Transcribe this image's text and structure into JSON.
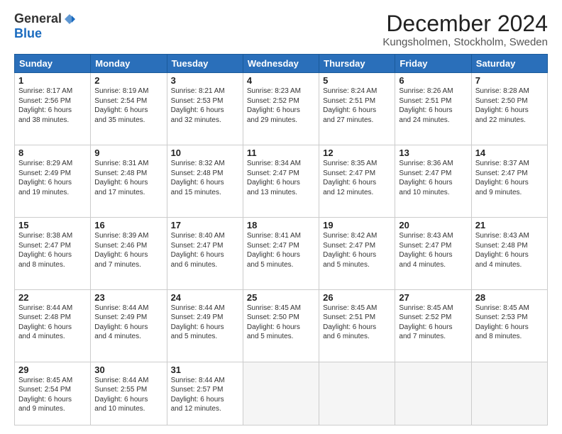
{
  "logo": {
    "general": "General",
    "blue": "Blue"
  },
  "title": "December 2024",
  "location": "Kungsholmen, Stockholm, Sweden",
  "days_header": [
    "Sunday",
    "Monday",
    "Tuesday",
    "Wednesday",
    "Thursday",
    "Friday",
    "Saturday"
  ],
  "weeks": [
    [
      {
        "day": "1",
        "info": "Sunrise: 8:17 AM\nSunset: 2:56 PM\nDaylight: 6 hours\nand 38 minutes."
      },
      {
        "day": "2",
        "info": "Sunrise: 8:19 AM\nSunset: 2:54 PM\nDaylight: 6 hours\nand 35 minutes."
      },
      {
        "day": "3",
        "info": "Sunrise: 8:21 AM\nSunset: 2:53 PM\nDaylight: 6 hours\nand 32 minutes."
      },
      {
        "day": "4",
        "info": "Sunrise: 8:23 AM\nSunset: 2:52 PM\nDaylight: 6 hours\nand 29 minutes."
      },
      {
        "day": "5",
        "info": "Sunrise: 8:24 AM\nSunset: 2:51 PM\nDaylight: 6 hours\nand 27 minutes."
      },
      {
        "day": "6",
        "info": "Sunrise: 8:26 AM\nSunset: 2:51 PM\nDaylight: 6 hours\nand 24 minutes."
      },
      {
        "day": "7",
        "info": "Sunrise: 8:28 AM\nSunset: 2:50 PM\nDaylight: 6 hours\nand 22 minutes."
      }
    ],
    [
      {
        "day": "8",
        "info": "Sunrise: 8:29 AM\nSunset: 2:49 PM\nDaylight: 6 hours\nand 19 minutes."
      },
      {
        "day": "9",
        "info": "Sunrise: 8:31 AM\nSunset: 2:48 PM\nDaylight: 6 hours\nand 17 minutes."
      },
      {
        "day": "10",
        "info": "Sunrise: 8:32 AM\nSunset: 2:48 PM\nDaylight: 6 hours\nand 15 minutes."
      },
      {
        "day": "11",
        "info": "Sunrise: 8:34 AM\nSunset: 2:47 PM\nDaylight: 6 hours\nand 13 minutes."
      },
      {
        "day": "12",
        "info": "Sunrise: 8:35 AM\nSunset: 2:47 PM\nDaylight: 6 hours\nand 12 minutes."
      },
      {
        "day": "13",
        "info": "Sunrise: 8:36 AM\nSunset: 2:47 PM\nDaylight: 6 hours\nand 10 minutes."
      },
      {
        "day": "14",
        "info": "Sunrise: 8:37 AM\nSunset: 2:47 PM\nDaylight: 6 hours\nand 9 minutes."
      }
    ],
    [
      {
        "day": "15",
        "info": "Sunrise: 8:38 AM\nSunset: 2:47 PM\nDaylight: 6 hours\nand 8 minutes."
      },
      {
        "day": "16",
        "info": "Sunrise: 8:39 AM\nSunset: 2:46 PM\nDaylight: 6 hours\nand 7 minutes."
      },
      {
        "day": "17",
        "info": "Sunrise: 8:40 AM\nSunset: 2:47 PM\nDaylight: 6 hours\nand 6 minutes."
      },
      {
        "day": "18",
        "info": "Sunrise: 8:41 AM\nSunset: 2:47 PM\nDaylight: 6 hours\nand 5 minutes."
      },
      {
        "day": "19",
        "info": "Sunrise: 8:42 AM\nSunset: 2:47 PM\nDaylight: 6 hours\nand 5 minutes."
      },
      {
        "day": "20",
        "info": "Sunrise: 8:43 AM\nSunset: 2:47 PM\nDaylight: 6 hours\nand 4 minutes."
      },
      {
        "day": "21",
        "info": "Sunrise: 8:43 AM\nSunset: 2:48 PM\nDaylight: 6 hours\nand 4 minutes."
      }
    ],
    [
      {
        "day": "22",
        "info": "Sunrise: 8:44 AM\nSunset: 2:48 PM\nDaylight: 6 hours\nand 4 minutes."
      },
      {
        "day": "23",
        "info": "Sunrise: 8:44 AM\nSunset: 2:49 PM\nDaylight: 6 hours\nand 4 minutes."
      },
      {
        "day": "24",
        "info": "Sunrise: 8:44 AM\nSunset: 2:49 PM\nDaylight: 6 hours\nand 5 minutes."
      },
      {
        "day": "25",
        "info": "Sunrise: 8:45 AM\nSunset: 2:50 PM\nDaylight: 6 hours\nand 5 minutes."
      },
      {
        "day": "26",
        "info": "Sunrise: 8:45 AM\nSunset: 2:51 PM\nDaylight: 6 hours\nand 6 minutes."
      },
      {
        "day": "27",
        "info": "Sunrise: 8:45 AM\nSunset: 2:52 PM\nDaylight: 6 hours\nand 7 minutes."
      },
      {
        "day": "28",
        "info": "Sunrise: 8:45 AM\nSunset: 2:53 PM\nDaylight: 6 hours\nand 8 minutes."
      }
    ],
    [
      {
        "day": "29",
        "info": "Sunrise: 8:45 AM\nSunset: 2:54 PM\nDaylight: 6 hours\nand 9 minutes."
      },
      {
        "day": "30",
        "info": "Sunrise: 8:44 AM\nSunset: 2:55 PM\nDaylight: 6 hours\nand 10 minutes."
      },
      {
        "day": "31",
        "info": "Sunrise: 8:44 AM\nSunset: 2:57 PM\nDaylight: 6 hours\nand 12 minutes."
      },
      {
        "day": "",
        "info": ""
      },
      {
        "day": "",
        "info": ""
      },
      {
        "day": "",
        "info": ""
      },
      {
        "day": "",
        "info": ""
      }
    ]
  ]
}
